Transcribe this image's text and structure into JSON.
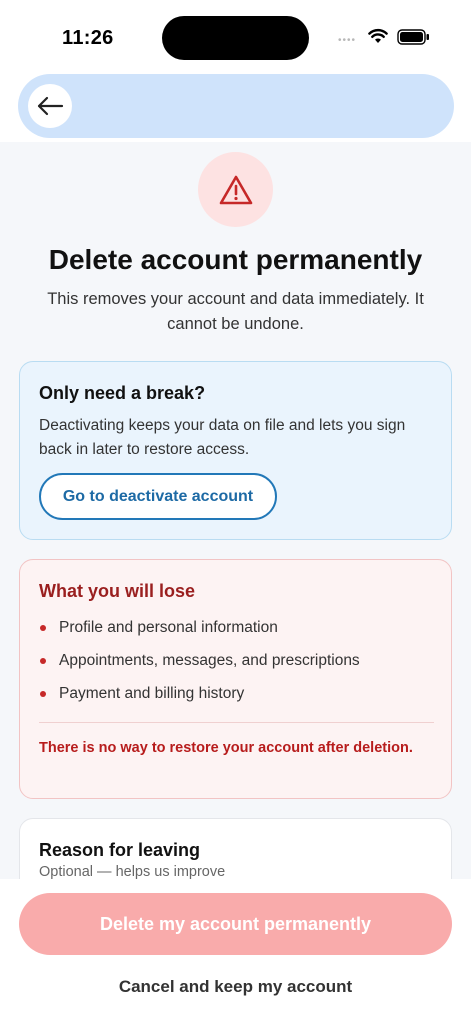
{
  "status_bar": {
    "time": "11:26",
    "signal": "••••",
    "wifi_icon": "wifi-icon",
    "battery_icon": "battery-icon"
  },
  "header": {
    "back_icon": "arrow-left-icon",
    "pill_color": "#cfe3fb"
  },
  "warning": {
    "icon": "warning-triangle-icon",
    "title": "Delete account permanently",
    "subtitle": "This removes your account and data immediately. It cannot be undone."
  },
  "break_card": {
    "title": "Only need a break?",
    "body": "Deactivating keeps your data on file and lets you sign back in later to restore access.",
    "button_label": "Go to deactivate account"
  },
  "lose_card": {
    "title": "What you will lose",
    "items": [
      "Profile and personal information",
      "Appointments, messages, and prescriptions",
      "Payment and billing history"
    ],
    "warning": "There is no way to restore your account after deletion."
  },
  "reason_card": {
    "title": "Reason for leaving",
    "hint": "Optional — helps us improve"
  },
  "actions": {
    "delete_label": "Delete my account permanently",
    "cancel_label": "Cancel and keep my account"
  },
  "colors": {
    "accent_blue": "#2278b8",
    "danger_red": "#b71c1c",
    "delete_disabled": "#f9abab"
  }
}
